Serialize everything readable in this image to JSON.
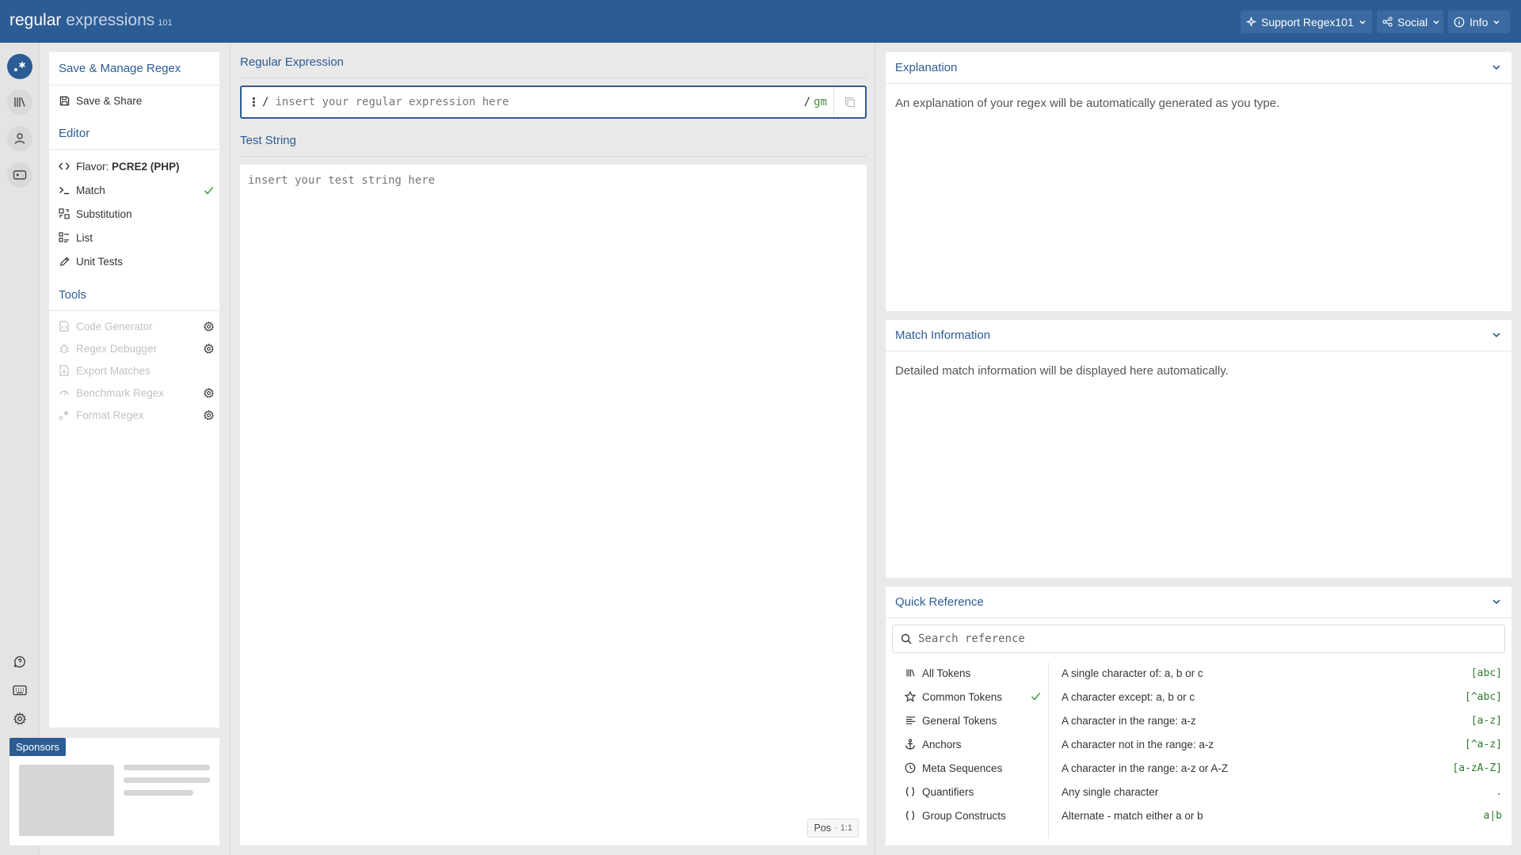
{
  "brand": {
    "word1": "regular",
    "word2": "expressions",
    "suffix": "101"
  },
  "header": {
    "support_label": "Support Regex101",
    "social_label": "Social",
    "info_label": "Info"
  },
  "rail": {
    "top_icons": [
      "regex-icon",
      "library-icon",
      "user-icon",
      "quiz-icon"
    ],
    "bottom_icons": [
      "help-icon",
      "keyboard-icon",
      "settings-icon"
    ]
  },
  "sidebar": {
    "save_heading": "Save & Manage Regex",
    "save_share": "Save & Share",
    "editor_heading": "Editor",
    "flavor_prefix": "Flavor:",
    "flavor_value": "PCRE2 (PHP)",
    "modes": [
      "Match",
      "Substitution",
      "List",
      "Unit Tests"
    ],
    "tools_heading": "Tools",
    "tools": [
      "Code Generator",
      "Regex Debugger",
      "Export Matches",
      "Benchmark Regex",
      "Format Regex"
    ]
  },
  "sponsors": {
    "label": "Sponsors"
  },
  "regex": {
    "title": "Regular Expression",
    "handle": "⋮",
    "open_delim": "/",
    "placeholder": "insert your regular expression here",
    "close_delim": "/",
    "flags": "gm"
  },
  "test_string": {
    "title": "Test String",
    "placeholder": "insert your test string here",
    "pos_label": "Pos",
    "pos_value": "1:1"
  },
  "explanation": {
    "title": "Explanation",
    "text": "An explanation of your regex will be automatically generated as you type."
  },
  "match_info": {
    "title": "Match Information",
    "text": "Detailed match information will be displayed here automatically."
  },
  "quick_ref": {
    "title": "Quick Reference",
    "search_placeholder": "Search reference",
    "categories": [
      "All Tokens",
      "Common Tokens",
      "General Tokens",
      "Anchors",
      "Meta Sequences",
      "Quantifiers",
      "Group Constructs"
    ],
    "selected_category": "Common Tokens",
    "rows": [
      {
        "desc": "A single character of: a, b or c",
        "code": "[abc]"
      },
      {
        "desc": "A character except: a, b or c",
        "code": "[^abc]"
      },
      {
        "desc": "A character in the range: a-z",
        "code": "[a-z]"
      },
      {
        "desc": "A character not in the range: a-z",
        "code": "[^a-z]"
      },
      {
        "desc": "A character in the range: a-z or A-Z",
        "code": "[a-zA-Z]"
      },
      {
        "desc": "Any single character",
        "code": "."
      },
      {
        "desc": "Alternate - match either a or b",
        "code": "a|b"
      }
    ]
  },
  "colors": {
    "brand": "#2c5c94",
    "code": "#2c7a2c",
    "flags": "#4a8a3c"
  }
}
